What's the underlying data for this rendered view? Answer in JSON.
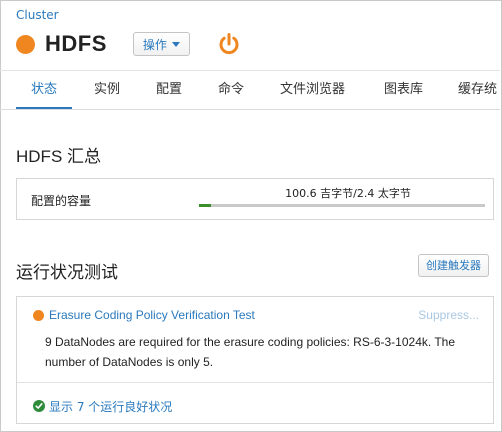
{
  "header": {
    "cluster_label": "Cluster",
    "service_name": "HDFS",
    "actions_label": "操作",
    "status_color": "#f0861f",
    "power_icon": "power-icon"
  },
  "tabs": [
    {
      "label": "状态",
      "active": true
    },
    {
      "label": "实例",
      "active": false
    },
    {
      "label": "配置",
      "active": false
    },
    {
      "label": "命令",
      "active": false
    },
    {
      "label": "文件浏览器",
      "active": false
    },
    {
      "label": "图表库",
      "active": false
    },
    {
      "label": "缓存统",
      "active": false
    }
  ],
  "summary": {
    "title": "HDFS 汇总",
    "capacity_label": "配置的容量",
    "capacity_value": "100.6 吉字节/2.4 太字节",
    "capacity_used_fraction": 0.041
  },
  "health": {
    "title": "运行状况测试",
    "trigger_button": "创建触发器",
    "test_title": "Erasure Coding Policy Verification Test",
    "suppress_label": "Suppress...",
    "test_description": "9 DataNodes are required for the erasure coding policies: RS-6-3-1024k. The number of DataNodes is only 5.",
    "good_label": "显示 7 个运行良好状况"
  },
  "colors": {
    "accent": "#2a79bd",
    "warning": "#f0861f",
    "good": "#2e8b3a"
  }
}
